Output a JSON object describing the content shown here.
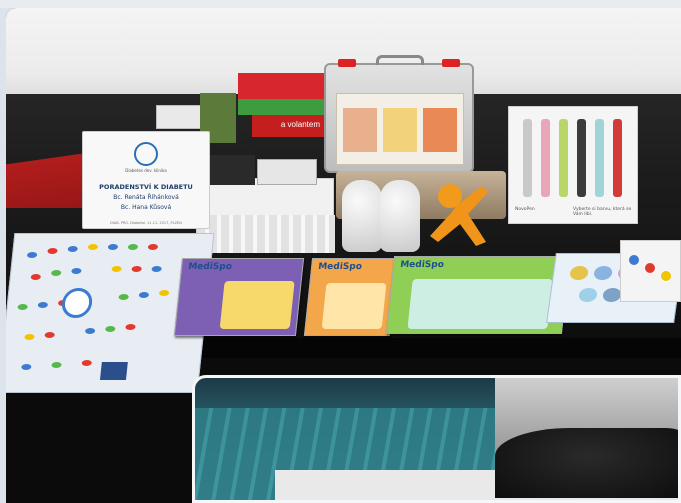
{
  "scene": {
    "sign": {
      "logo_text": "Diabetes dev. klinika",
      "title": "PORADENSTVÍ K DIABETU",
      "line1": "Bc. Renáta Říhánková",
      "line2": "Bc. Hana Kůsová",
      "footer": "DIAB. PRO. Diabetol.     11.11. 2017, PLZEN"
    },
    "book_label": "a volantem",
    "booklet_brand": "MediSpo",
    "pens_caption_left": "NovoPen",
    "pens_caption_right": "Vyberte si barvu, která se Vám líbí.",
    "pen_colors": [
      "#c9c9c9",
      "#e8a6b8",
      "#b9d66a",
      "#3b3b3b",
      "#9fd4d8",
      "#d33a3a"
    ],
    "accent_red": "#b11d1d",
    "accent_blue": "#1e4f8c"
  }
}
